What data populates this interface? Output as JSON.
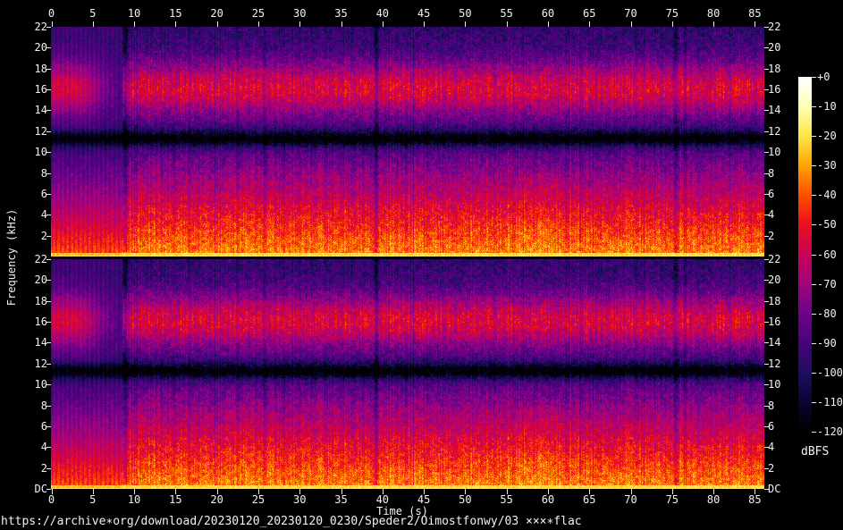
{
  "figure": {
    "xlabel": "Time (s)",
    "ylabel": "Frequency (kHz)",
    "footer_url": "https://archive∗org/download/20230120_20230120_0230/Speder2/Oimostfonwy/03 ×××∗flac"
  },
  "chart_data": {
    "type": "heatmap",
    "subtype": "stereo-audio-spectrogram",
    "channels": 2,
    "title": "",
    "xlabel": "Time (s)",
    "ylabel": "Frequency (kHz)",
    "x_ticks_s": [
      0,
      5,
      10,
      15,
      20,
      25,
      30,
      35,
      40,
      45,
      50,
      55,
      60,
      65,
      70,
      75,
      80,
      85
    ],
    "x_range_s": [
      0,
      86.2
    ],
    "y_ticks_khz": [
      "22",
      "20",
      "18",
      "16",
      "14",
      "12",
      "10",
      "8",
      "6",
      "4",
      "2",
      "DC"
    ],
    "y_range_khz": [
      0,
      22
    ],
    "grid": false,
    "legend_position": "right-colorbar",
    "colorbar": {
      "label": "dBFS",
      "tick_labels": [
        "+0",
        "-10",
        "-20",
        "-30",
        "-40",
        "-50",
        "-60",
        "-70",
        "-80",
        "-90",
        "-100",
        "-110",
        "-120"
      ],
      "range_db": [
        0,
        -120
      ],
      "palette_stops": [
        {
          "db": 0,
          "color": "#ffffff"
        },
        {
          "db": -10,
          "color": "#ffffb2"
        },
        {
          "db": -20,
          "color": "#ffe345"
        },
        {
          "db": -30,
          "color": "#ffa200"
        },
        {
          "db": -40,
          "color": "#ff4e00"
        },
        {
          "db": -50,
          "color": "#ea0e1d"
        },
        {
          "db": -60,
          "color": "#c80256"
        },
        {
          "db": -70,
          "color": "#a1037e"
        },
        {
          "db": -80,
          "color": "#6f028b"
        },
        {
          "db": -90,
          "color": "#49027c"
        },
        {
          "db": -100,
          "color": "#1f0d63"
        },
        {
          "db": -110,
          "color": "#0a0433"
        },
        {
          "db": -120,
          "color": "#000000"
        }
      ]
    },
    "features": {
      "description": "Two nearly identical channel panels. Quiet intro 0-8.5s with magenta high band ~16 kHz and striped orange lows; dense broadband music from ~9s: red/orange below 10 kHz, dark notch band ~11.3 kHz, red bump 14-18 kHz, dark indigo near 22 kHz, bright yellow band at DC.",
      "intro_end_s": 8.55,
      "transition_gap_center_s": 8.95,
      "hi_band_center_khz": 16.1,
      "notch_center_khz": 11.35,
      "notch_depth_db": -28,
      "dark_column_times_s": [
        39.3,
        75.4
      ],
      "bright_lowfreq_zone_s": [
        56.5,
        61.5
      ],
      "dc_band_level_db": -24
    }
  }
}
